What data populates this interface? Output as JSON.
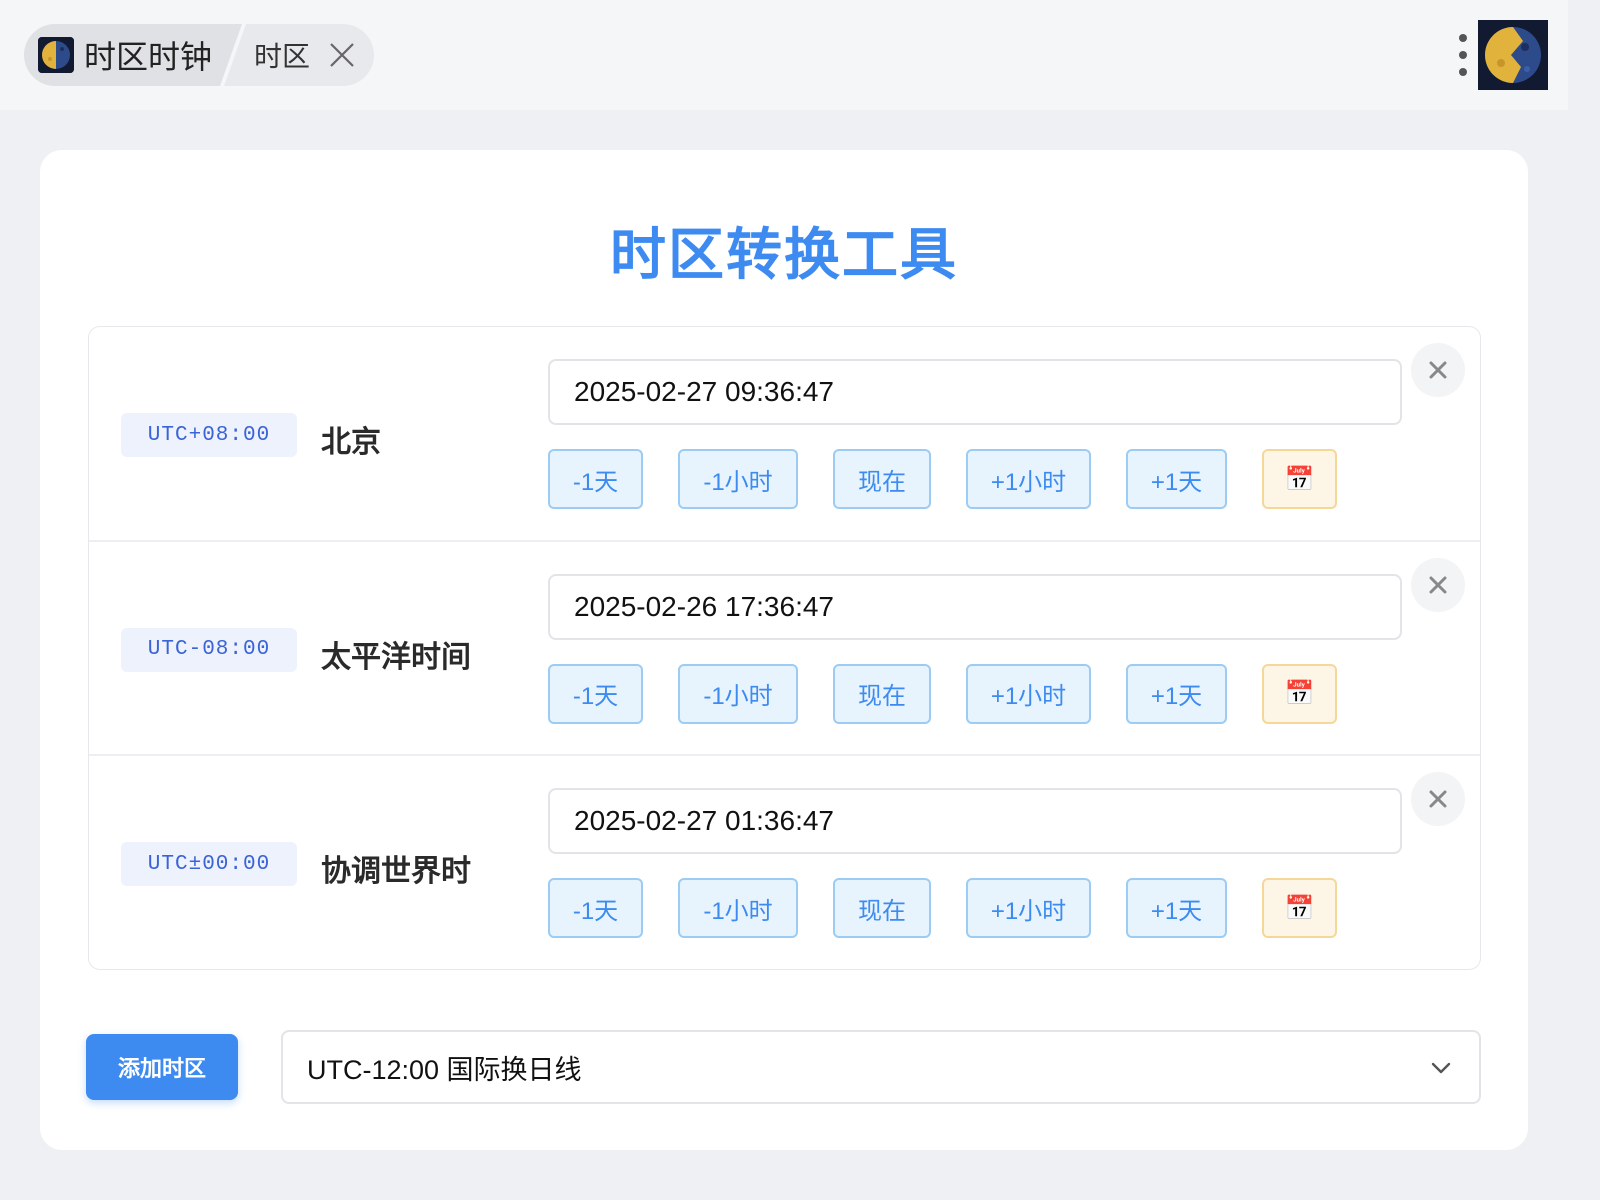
{
  "window": {
    "app_tab_title": "时区时钟",
    "sub_tab_title": "时区"
  },
  "main": {
    "title": "时区转换工具",
    "zones": [
      {
        "utc": "UTC+08:00",
        "name": "北京",
        "time": "2025-02-27 09:36:47"
      },
      {
        "utc": "UTC-08:00",
        "name": "太平洋时间",
        "time": "2025-02-26 17:36:47"
      },
      {
        "utc": "UTC±00:00",
        "name": "协调世界时",
        "time": "2025-02-27 01:36:47"
      }
    ],
    "buttons": {
      "minus_day": "-1天",
      "minus_hour": "-1小时",
      "now": "现在",
      "plus_hour": "+1小时",
      "plus_day": "+1天",
      "calendar_icon": "📅"
    },
    "add_button": "添加时区",
    "select_value": "UTC-12:00 国际换日线"
  },
  "colors": {
    "accent": "#3d8bf0",
    "badge_text": "#3a63d6",
    "calendar_bg": "#fdf6e6"
  },
  "icons": [
    "moon-app-icon",
    "close-icon",
    "kebab-menu-icon",
    "avatar-moon-icon",
    "calendar-icon",
    "remove-x-icon",
    "chevron-down-icon"
  ]
}
